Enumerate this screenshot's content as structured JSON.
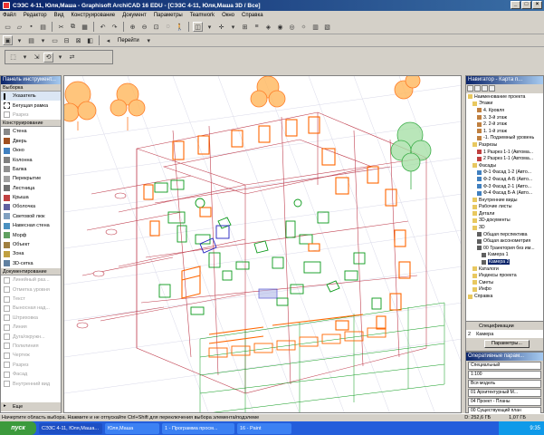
{
  "title": "СЭЗС 4-11, Юля,Маша - Graphisoft ArchiCAD 16 EDU - [СЭЗС 4-11, Юля,Маша 3D / Все]",
  "menu": [
    "Файл",
    "Редактор",
    "Вид",
    "Конструирование",
    "Документ",
    "Параметры",
    "Teamwork",
    "Окно",
    "Справка"
  ],
  "toolbar": {
    "goto_label": "Перейти"
  },
  "toolbox": {
    "title": "Панель инструмент...",
    "sections": {
      "select": "Выборка",
      "construct": "Конструирование",
      "document": "Документирование"
    },
    "select_tools": [
      "Указатель",
      "Бегущая рамка",
      "Разрез"
    ],
    "construct_tools": [
      "Стена",
      "Дверь",
      "Окно",
      "Колонна",
      "Балка",
      "Перекрытие",
      "Лестница",
      "Крыша",
      "Оболочка",
      "Световой люк",
      "Навесная стена",
      "Морф",
      "Объект",
      "Зона",
      "3D-сетка"
    ],
    "document_tools": [
      "Линейный раз...",
      "Отметка уровня",
      "Текст",
      "Выносная над...",
      "Штриховка",
      "Линия",
      "Дуга/окружн...",
      "Полилиния",
      "Чертеж",
      "Разрез",
      "Фасад",
      "Внутренний вид"
    ],
    "more": "Еще"
  },
  "navigator": {
    "title": "Навигатор - Карта п...",
    "items": [
      {
        "label": "Наименование проекта",
        "level": 0,
        "icon": "folder"
      },
      {
        "label": "Этажи",
        "level": 1,
        "icon": "folder"
      },
      {
        "label": "4. Кровля",
        "level": 2,
        "icon": "story"
      },
      {
        "label": "3. 3-й этаж",
        "level": 2,
        "icon": "story"
      },
      {
        "label": "2. 2-й этаж",
        "level": 2,
        "icon": "story"
      },
      {
        "label": "1. 1-й этаж",
        "level": 2,
        "icon": "story"
      },
      {
        "label": "-1. Подземный уровень",
        "level": 2,
        "icon": "story"
      },
      {
        "label": "Разрезы",
        "level": 1,
        "icon": "folder"
      },
      {
        "label": "1 Разрез 1-1 (Автома...",
        "level": 2,
        "icon": "section"
      },
      {
        "label": "2 Разрез 1-1 (Автома...",
        "level": 2,
        "icon": "section"
      },
      {
        "label": "Фасады",
        "level": 1,
        "icon": "folder"
      },
      {
        "label": "Ф-1 Фасад 1-2 (Авто...",
        "level": 2,
        "icon": "elev"
      },
      {
        "label": "Ф-2 Фасад А-Б (Авто...",
        "level": 2,
        "icon": "elev"
      },
      {
        "label": "Ф-3 Фасад 2-1 (Авто...",
        "level": 2,
        "icon": "elev"
      },
      {
        "label": "Ф-4 Фасад Б-А (Авто...",
        "level": 2,
        "icon": "elev"
      },
      {
        "label": "Внутренние виды",
        "level": 1,
        "icon": "folder"
      },
      {
        "label": "Рабочие листы",
        "level": 1,
        "icon": "folder"
      },
      {
        "label": "Детали",
        "level": 1,
        "icon": "folder"
      },
      {
        "label": "3D-документы",
        "level": 1,
        "icon": "folder"
      },
      {
        "label": "3D",
        "level": 1,
        "icon": "folder"
      },
      {
        "label": "Общая перспектива",
        "level": 2,
        "icon": "cam"
      },
      {
        "label": "Общая аксонометрия",
        "level": 2,
        "icon": "cam"
      },
      {
        "label": "00 Траектория без им...",
        "level": 2,
        "icon": "cam"
      },
      {
        "label": "Камера 1",
        "level": 3,
        "icon": "cam"
      },
      {
        "label": "Камера 2",
        "level": 3,
        "icon": "cam",
        "highlight": true
      },
      {
        "label": "Каталоги",
        "level": 1,
        "icon": "folder"
      },
      {
        "label": "Индексы проекта",
        "level": 1,
        "icon": "folder"
      },
      {
        "label": "Сметы",
        "level": 1,
        "icon": "folder"
      },
      {
        "label": "Инфо",
        "level": 1,
        "icon": "folder"
      },
      {
        "label": "Справка",
        "level": 0,
        "icon": "folder"
      }
    ],
    "spec_label": "Спецификации",
    "camera_num": "2",
    "camera_label": "Камера",
    "params_button": "Параметры..."
  },
  "props": {
    "title": "Оперативные парам...",
    "rows": [
      "Специальный",
      "1:100",
      "Вся модель",
      "01 Архитектурный М...",
      "04 Проект - Планы",
      "00 Существующий план"
    ]
  },
  "status": {
    "message": "Начертите область выбора. Нажмите и не отпускайте Ctrl+Shift для переключения выбора элемента/подэлеме",
    "disk": "D: 252,6 ГБ",
    "mem": "1,07 ГБ"
  },
  "taskbar": {
    "start": "пуск",
    "tasks": [
      "СЭЗС 4-11, Юля,Маша...",
      "Юля,Маша",
      "1 - Программа просм...",
      "16 - Paint"
    ],
    "time": "9:35"
  },
  "colors": {
    "orange": "#ff6600",
    "green": "#0a9a1a",
    "redline": "#c04050",
    "blue": "#2020c0"
  }
}
